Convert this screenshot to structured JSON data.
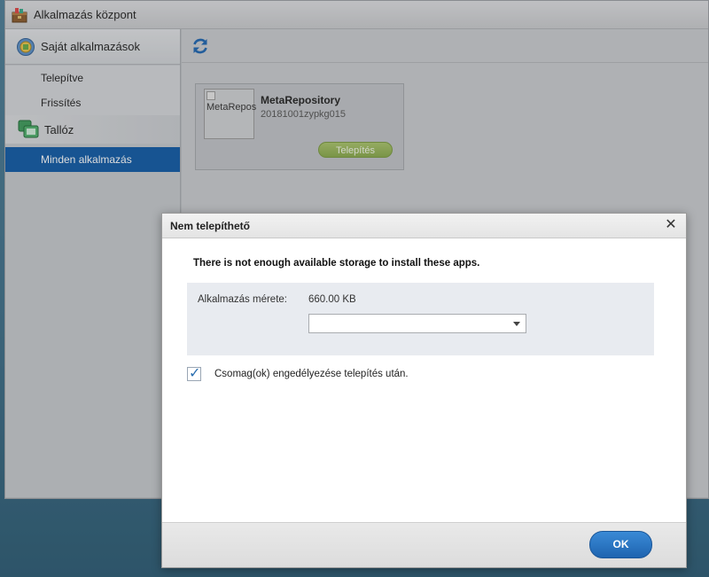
{
  "window": {
    "title": "Alkalmazás központ"
  },
  "sidebar": {
    "section_my_apps": "Saját alkalmazások",
    "items": [
      {
        "label": "Telepítve"
      },
      {
        "label": "Frissítés"
      }
    ],
    "section_browse": "Tallóz",
    "browse_items": [
      {
        "label": "Minden alkalmazás",
        "active": true
      }
    ]
  },
  "toolbar": {
    "refresh_icon": "refresh-icon"
  },
  "app_card": {
    "thumb_alt": "MetaRepos",
    "name": "MetaRepository",
    "version": "20181001zypkg015",
    "install_label": "Telepítés"
  },
  "dialog": {
    "title": "Nem telepíthető",
    "message": "There is not enough available storage to install these apps.",
    "size_label": "Alkalmazás mérete:",
    "size_value": "660.00 KB",
    "volume_value": "",
    "checkbox_label": "Csomag(ok) engedélyezése telepítés után.",
    "checkbox_checked": true,
    "ok_label": "OK",
    "close_glyph": "✕"
  },
  "colors": {
    "accent": "#0f5aa5",
    "install_green": "#95b554",
    "ok_blue": "#2a75c3"
  }
}
